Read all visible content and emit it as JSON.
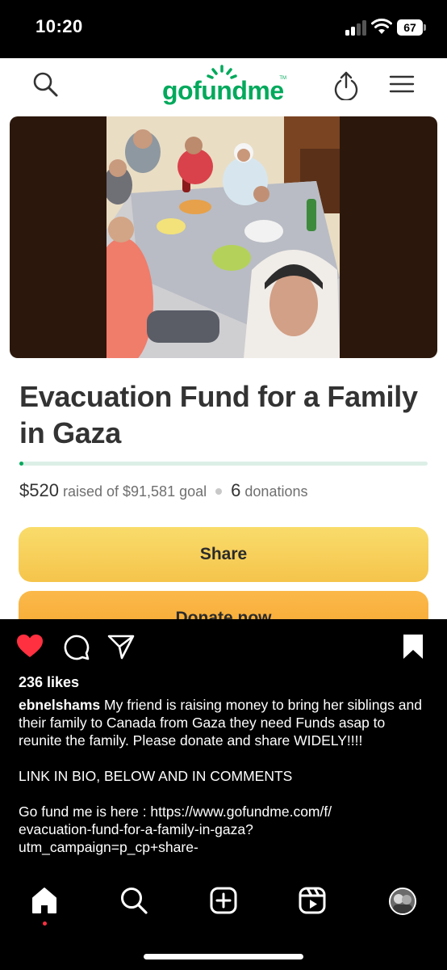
{
  "status_bar": {
    "time": "10:20",
    "battery": "67"
  },
  "web": {
    "logo": "gofundme",
    "logo_tm": "TM",
    "title": "Evacuation Fund for a Family in Gaza",
    "raised_amount": "$520",
    "raised_text": "raised of $91,581 goal",
    "donation_count": "6",
    "donations_text": "donations",
    "progress_fraction": 0.0057,
    "share_label": "Share",
    "donate_label": "Donate now"
  },
  "post": {
    "likes": "236 likes",
    "username": "ebnelshams",
    "caption_first": "My friend is raising money to bring her siblings and their family to Canada from Gaza they need Funds asap to reunite the family. Please donate and share WIDELY!!!!",
    "caption_link_line": "LINK IN BIO, BELOW AND IN COMMENTS",
    "caption_url_1": "Go fund me is here : https://www.gofundme.com/f/",
    "caption_url_2": "evacuation-fund-for-a-family-in-gaza?",
    "caption_url_3": "utm_campaign=p_cp+share-"
  },
  "colors": {
    "brand_green": "#02a95c",
    "share_button": "#f7cf5b",
    "donate_button": "#f8ae3a",
    "like_red": "#ff3040"
  },
  "icons": {
    "status": [
      "signal-icon",
      "wifi-icon",
      "battery-icon"
    ],
    "web_header": [
      "search-icon",
      "upload-icon",
      "menu-icon"
    ],
    "post_actions": [
      "heart-icon",
      "comment-icon",
      "send-icon",
      "bookmark-icon"
    ],
    "tabs": [
      "home-icon",
      "search-icon",
      "create-icon",
      "reels-icon",
      "profile-avatar"
    ]
  }
}
